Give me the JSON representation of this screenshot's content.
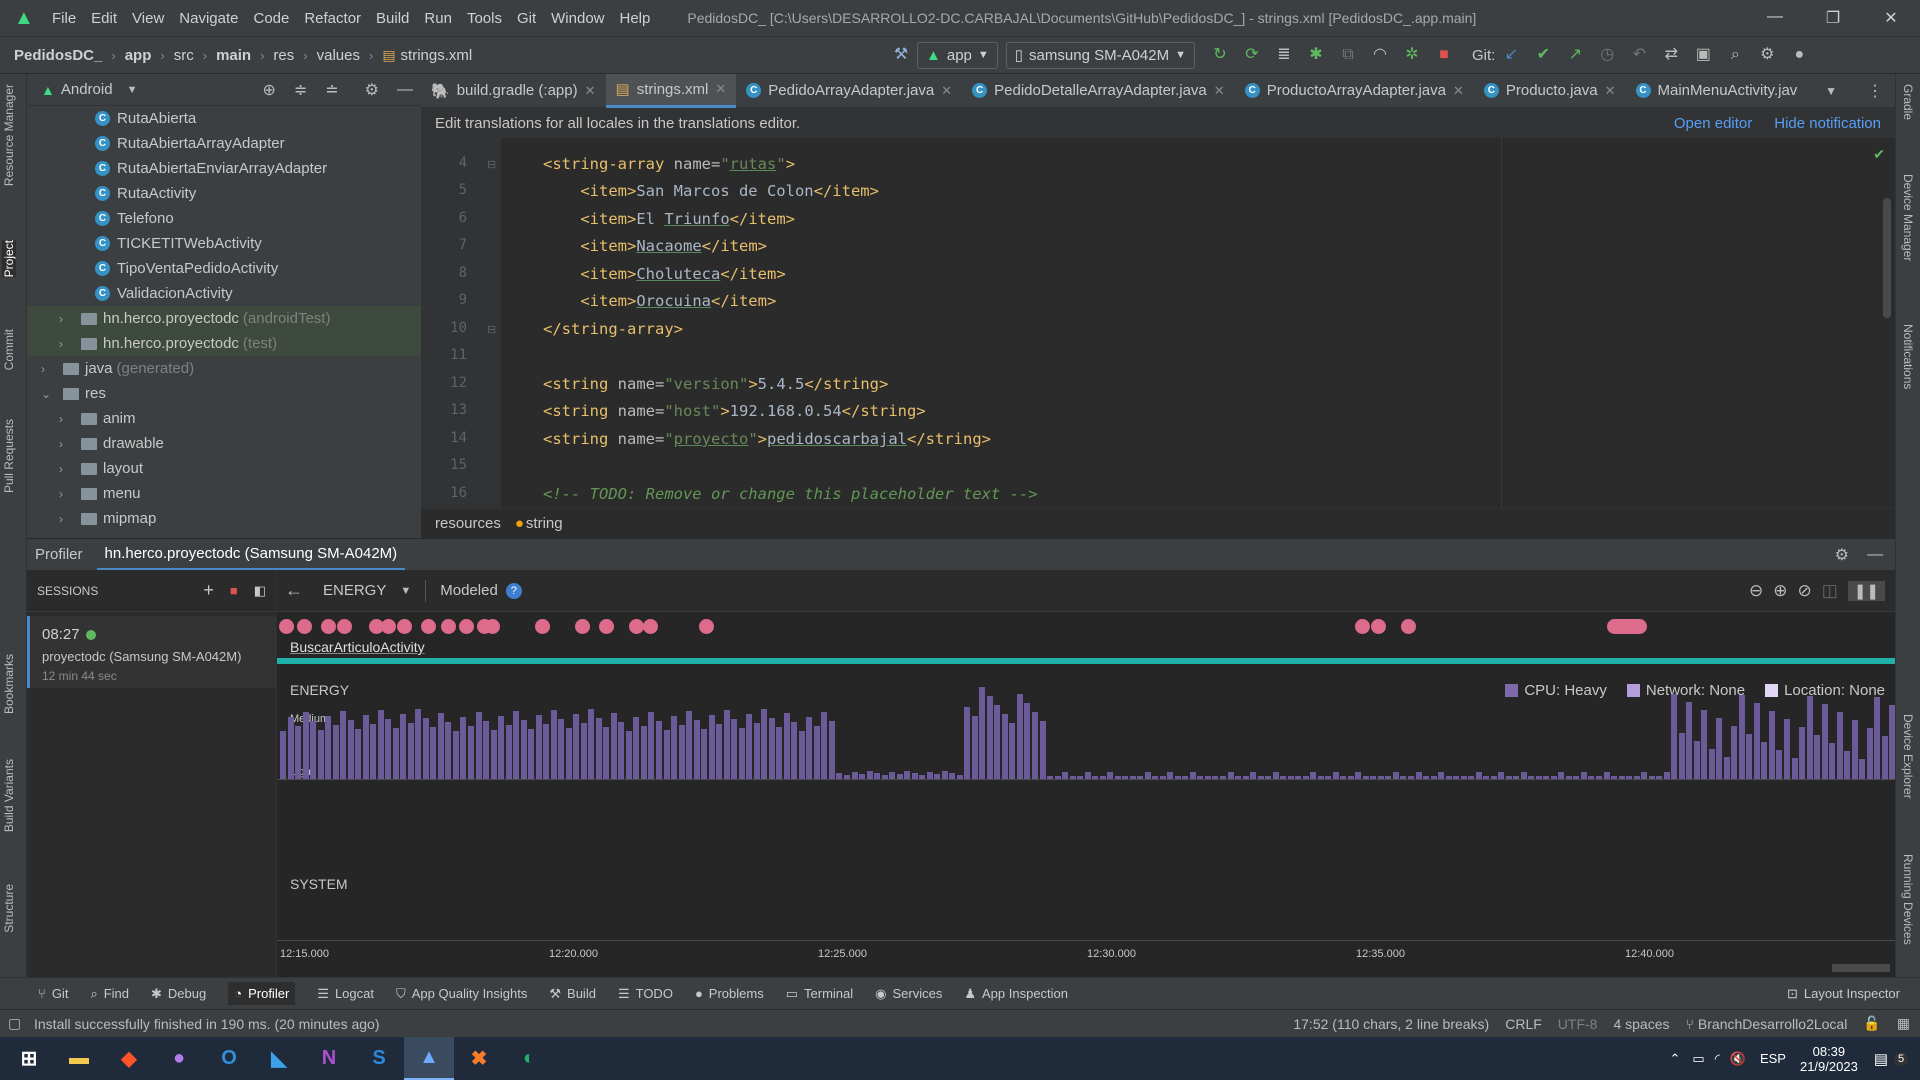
{
  "app": {
    "title": "PedidosDC_ [C:\\Users\\DESARROLLO2-DC.CARBAJAL\\Documents\\GitHub\\PedidosDC_] - strings.xml [PedidosDC_.app.main]"
  },
  "menu": [
    "File",
    "Edit",
    "View",
    "Navigate",
    "Code",
    "Refactor",
    "Build",
    "Run",
    "Tools",
    "Git",
    "Window",
    "Help"
  ],
  "nav": {
    "crumbs": [
      "PedidosDC_",
      "app",
      "src",
      "main",
      "res",
      "values",
      "strings.xml"
    ],
    "run_config": "app",
    "device": "samsung SM-A042M",
    "git_label": "Git:"
  },
  "left_strip": [
    "Resource Manager",
    "Project",
    "Commit",
    "Pull Requests",
    "Bookmarks",
    "Build Variants",
    "Structure"
  ],
  "right_strip": [
    "Gradle",
    "Device Manager",
    "Notifications",
    "Device Explorer",
    "Running Devices"
  ],
  "project": {
    "view": "Android",
    "items": [
      {
        "label": "RutaAbierta",
        "kind": "class",
        "indent": 5
      },
      {
        "label": "RutaAbiertaArrayAdapter",
        "kind": "class",
        "indent": 5
      },
      {
        "label": "RutaAbiertaEnviarArrayAdapter",
        "kind": "class",
        "indent": 5
      },
      {
        "label": "RutaActivity",
        "kind": "class",
        "indent": 5
      },
      {
        "label": "Telefono",
        "kind": "class",
        "indent": 5
      },
      {
        "label": "TICKETITWebActivity",
        "kind": "class",
        "indent": 5
      },
      {
        "label": "TipoVentaPedidoActivity",
        "kind": "class",
        "indent": 5
      },
      {
        "label": "ValidacionActivity",
        "kind": "class",
        "indent": 5
      },
      {
        "label": "hn.herco.proyectodc",
        "suffix": "(androidTest)",
        "kind": "folder",
        "indent": 3,
        "chev": "›",
        "hl": true
      },
      {
        "label": "hn.herco.proyectodc",
        "suffix": "(test)",
        "kind": "folder",
        "indent": 3,
        "chev": "›",
        "hl": true
      },
      {
        "label": "java",
        "suffix": "(generated)",
        "kind": "folder",
        "indent": 2,
        "chev": "›"
      },
      {
        "label": "res",
        "kind": "folder",
        "indent": 2,
        "chev": "⌄"
      },
      {
        "label": "anim",
        "kind": "folder",
        "indent": 3,
        "chev": "›"
      },
      {
        "label": "drawable",
        "kind": "folder",
        "indent": 3,
        "chev": "›"
      },
      {
        "label": "layout",
        "kind": "folder",
        "indent": 3,
        "chev": "›"
      },
      {
        "label": "menu",
        "kind": "folder",
        "indent": 3,
        "chev": "›"
      },
      {
        "label": "mipmap",
        "kind": "folder",
        "indent": 3,
        "chev": "›"
      }
    ]
  },
  "tabs": [
    {
      "label": "build.gradle (:app)",
      "icon": "gradle-icon"
    },
    {
      "label": "strings.xml",
      "icon": "xml-icon",
      "active": true
    },
    {
      "label": "PedidoArrayAdapter.java",
      "icon": "class-icon"
    },
    {
      "label": "PedidoDetalleArrayAdapter.java",
      "icon": "class-icon"
    },
    {
      "label": "ProductoArrayAdapter.java",
      "icon": "class-icon"
    },
    {
      "label": "Producto.java",
      "icon": "class-icon"
    },
    {
      "label": "MainMenuActivity.jav",
      "icon": "class-icon"
    }
  ],
  "notification": {
    "text": "Edit translations for all locales in the translations editor.",
    "open": "Open editor",
    "hide": "Hide notification"
  },
  "code": {
    "lines": [
      "4",
      "5",
      "6",
      "7",
      "8",
      "9",
      "10",
      "11",
      "12",
      "13",
      "14",
      "15",
      "16"
    ]
  },
  "editor_breadcrumb": [
    "resources",
    "string"
  ],
  "profiler": {
    "title": "Profiler",
    "session_tab": "hn.herco.proyectodc (Samsung SM-A042M)",
    "sessions_label": "SESSIONS",
    "session": {
      "time": "08:27",
      "name": "proyectodc (Samsung SM-A042M)",
      "duration": "12 min 44 sec"
    },
    "mode": "ENERGY",
    "modeled": "Modeled",
    "activity": "BuscarArticuloActivity",
    "energy_label": "ENERGY",
    "system_label": "SYSTEM",
    "level_medium": "Medium",
    "level_light": "Light",
    "legend": [
      {
        "label": "CPU: Heavy",
        "color": "#7e6aab"
      },
      {
        "label": "Network: None",
        "color": "#b39ddb"
      },
      {
        "label": "Location: None",
        "color": "#e1d5f5"
      }
    ],
    "ticks": [
      "12:15.000",
      "12:20.000",
      "12:25.000",
      "12:30.000",
      "12:35.000",
      "12:40.000"
    ],
    "accent": "#20b2aa",
    "event_color": "#dd6b8b",
    "bar_color": "#6c5b99"
  },
  "toolwindows": [
    "Git",
    "Find",
    "Debug",
    "Profiler",
    "Logcat",
    "App Quality Insights",
    "Build",
    "TODO",
    "Problems",
    "Terminal",
    "Services",
    "App Inspection"
  ],
  "layout_inspector": "Layout Inspector",
  "status": {
    "message": "Install successfully finished in 190 ms. (20 minutes ago)",
    "pos": "17:52 (110 chars, 2 line breaks)",
    "crlf": "CRLF",
    "enc": "UTF-8",
    "indent": "4 spaces",
    "branch": "BranchDesarrollo2Local"
  },
  "taskbar": {
    "lang": "ESP",
    "time": "08:39",
    "date": "21/9/2023",
    "notif_count": "5"
  }
}
